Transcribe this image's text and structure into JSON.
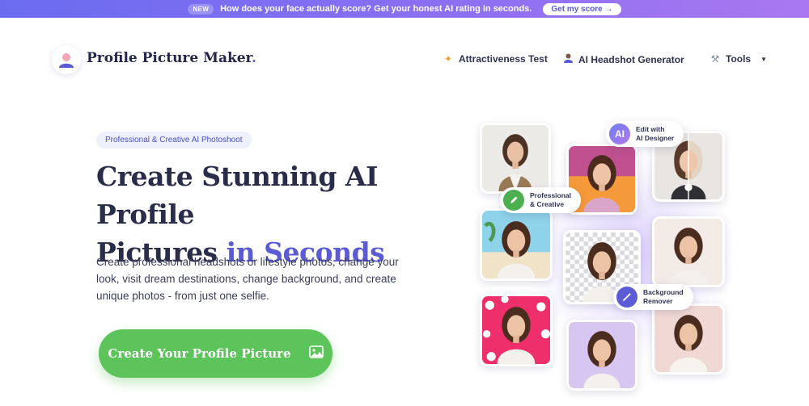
{
  "announcement": {
    "badge": "NEW",
    "message": "How does your face actually score? Get your honest AI rating in seconds.",
    "cta": "Get my score →"
  },
  "header": {
    "logo_text": "Profile Picture Maker",
    "logo_dot": ".",
    "nav": [
      {
        "label": "Attractiveness Test",
        "icon": "sparkles-icon"
      },
      {
        "label": "AI Headshot Generator",
        "icon": "person-icon"
      },
      {
        "label": "Tools",
        "icon": "tools-icon"
      }
    ]
  },
  "hero": {
    "pill": "Professional & Creative AI Photoshoot",
    "title_line1": "Create Stunning AI Profile",
    "title_line2_a": "Pictures",
    "title_line2_b": "in Seconds",
    "description": "Create professional headshots or lifestyle photos, change your look, visit dream destinations, change background, and create unique photos - from just one selfie.",
    "cta": "Create Your Profile Picture"
  },
  "collage": {
    "chips": [
      {
        "text": "Edit with\nAI Designer",
        "icon": "ai-icon",
        "icon_label": "AI"
      },
      {
        "text": "Professional\n& Creative",
        "icon": "pencil-icon"
      },
      {
        "text": "Background\nRemover",
        "icon": "magic-wand-icon"
      }
    ]
  },
  "colors": {
    "accent": "#5b5bd6",
    "cta_green": "#5cc45a",
    "heading": "#2a2d4a"
  }
}
